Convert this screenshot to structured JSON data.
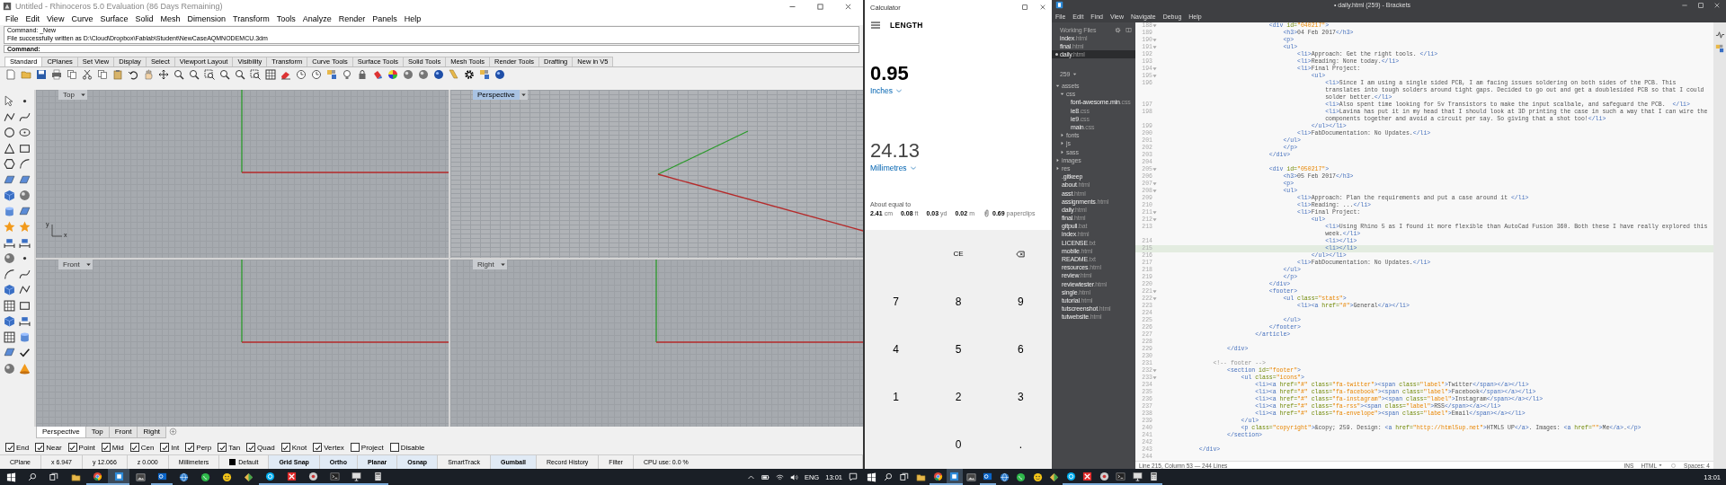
{
  "rhino": {
    "title": "Untitled - Rhinoceros 5.0 Evaluation (86 Days Remaining)",
    "menu": [
      "File",
      "Edit",
      "View",
      "Curve",
      "Surface",
      "Solid",
      "Mesh",
      "Dimension",
      "Transform",
      "Tools",
      "Analyze",
      "Render",
      "Panels",
      "Help"
    ],
    "command_history": [
      "Command: _New",
      "File successfully written as D:\\Cloud\\Dropbox\\Fablab\\Student\\NewCaseAQMNODEMCU.3dm"
    ],
    "command_prompt": "Command:",
    "toolbar_tabs": [
      {
        "label": "Standard",
        "selected": true
      },
      {
        "label": "CPlanes",
        "selected": false
      },
      {
        "label": "Set View",
        "selected": false
      },
      {
        "label": "Display",
        "selected": false
      },
      {
        "label": "Select",
        "selected": false
      },
      {
        "label": "Viewport Layout",
        "selected": false
      },
      {
        "label": "Visibility",
        "selected": false
      },
      {
        "label": "Transform",
        "selected": false
      },
      {
        "label": "Curve Tools",
        "selected": false
      },
      {
        "label": "Surface Tools",
        "selected": false
      },
      {
        "label": "Solid Tools",
        "selected": false
      },
      {
        "label": "Mesh Tools",
        "selected": false
      },
      {
        "label": "Render Tools",
        "selected": false
      },
      {
        "label": "Drafting",
        "selected": false
      },
      {
        "label": "New in V5",
        "selected": false
      }
    ],
    "viewports": [
      {
        "name": "Top",
        "selected": false,
        "kind": "parallel",
        "axis_labels": [
          "y",
          "x"
        ]
      },
      {
        "name": "Perspective",
        "selected": true,
        "kind": "perspective"
      },
      {
        "name": "Front",
        "selected": false,
        "kind": "parallel"
      },
      {
        "name": "Right",
        "selected": false,
        "kind": "parallel"
      }
    ],
    "viewport_tabs": [
      {
        "label": "Perspective",
        "selected": true
      },
      {
        "label": "Top",
        "selected": false
      },
      {
        "label": "Front",
        "selected": false
      },
      {
        "label": "Right",
        "selected": false
      }
    ],
    "osnaps": [
      {
        "label": "End",
        "checked": true
      },
      {
        "label": "Near",
        "checked": true
      },
      {
        "label": "Point",
        "checked": true
      },
      {
        "label": "Mid",
        "checked": true
      },
      {
        "label": "Cen",
        "checked": true
      },
      {
        "label": "Int",
        "checked": true
      },
      {
        "label": "Perp",
        "checked": true
      },
      {
        "label": "Tan",
        "checked": true
      },
      {
        "label": "Quad",
        "checked": true
      },
      {
        "label": "Knot",
        "checked": true
      },
      {
        "label": "Vertex",
        "checked": true
      },
      {
        "label": "Project",
        "checked": false
      },
      {
        "label": "Disable",
        "checked": false
      }
    ],
    "status_bar": [
      {
        "kind": "field",
        "text": "CPlane"
      },
      {
        "kind": "field",
        "text": "x 6.947"
      },
      {
        "kind": "field",
        "text": "y 12.066"
      },
      {
        "kind": "field",
        "text": "z 0.000"
      },
      {
        "kind": "field",
        "text": "Millimeters"
      },
      {
        "kind": "layer",
        "text": "Default"
      },
      {
        "kind": "toggle",
        "text": "Grid Snap",
        "on": true
      },
      {
        "kind": "toggle",
        "text": "Ortho",
        "on": true
      },
      {
        "kind": "toggle",
        "text": "Planar",
        "on": true
      },
      {
        "kind": "toggle",
        "text": "Osnap",
        "on": true
      },
      {
        "kind": "toggle",
        "text": "SmartTrack",
        "on": false
      },
      {
        "kind": "toggle",
        "text": "Gumball",
        "on": true
      },
      {
        "kind": "toggle",
        "text": "Record History",
        "on": false
      },
      {
        "kind": "toggle",
        "text": "Filter",
        "on": false
      },
      {
        "kind": "memo",
        "text": "CPU use: 0.0 %"
      }
    ]
  },
  "calculator": {
    "title": "Calculator",
    "mode": "LENGTH",
    "conversions": [
      {
        "value": "0.95",
        "unit": "Inches",
        "selected": true
      },
      {
        "value": "24.13",
        "unit": "Millimetres",
        "selected": false
      }
    ],
    "about_label": "About equal to",
    "equivalents": [
      {
        "kind": "plain",
        "value": "2.41",
        "unit": "cm"
      },
      {
        "kind": "plain",
        "value": "0.08",
        "unit": "ft"
      },
      {
        "kind": "plain",
        "value": "0.03",
        "unit": "yd"
      },
      {
        "kind": "plain",
        "value": "0.02",
        "unit": "m"
      },
      {
        "kind": "paperclip",
        "value": "0.69",
        "unit": "paperclips"
      }
    ],
    "key_rows": [
      [
        {
          "kind": "text",
          "label": "CE"
        },
        {
          "kind": "backspace"
        }
      ],
      [
        {
          "kind": "text",
          "label": "7"
        },
        {
          "kind": "text",
          "label": "8"
        },
        {
          "kind": "text",
          "label": "9"
        }
      ],
      [
        {
          "kind": "text",
          "label": "4"
        },
        {
          "kind": "text",
          "label": "5"
        },
        {
          "kind": "text",
          "label": "6"
        }
      ],
      [
        {
          "kind": "text",
          "label": "1"
        },
        {
          "kind": "text",
          "label": "2"
        },
        {
          "kind": "text",
          "label": "3"
        }
      ],
      [
        {
          "kind": "text",
          "label": "0"
        },
        {
          "kind": "text",
          "label": "."
        }
      ]
    ]
  },
  "brackets": {
    "title": "• daily.html (259) - Brackets",
    "menu": [
      "File",
      "Edit",
      "Find",
      "View",
      "Navigate",
      "Debug",
      "Help"
    ],
    "working_files_label": "Working Files",
    "working_files": [
      {
        "name": "index.html",
        "selected": false,
        "modified": false
      },
      {
        "name": "final.html",
        "selected": false,
        "modified": false
      },
      {
        "name": "daily.html",
        "selected": true,
        "modified": true
      }
    ],
    "project": "259",
    "tree": [
      {
        "kind": "folder",
        "name": "assets",
        "expanded": true,
        "children": [
          {
            "kind": "folder",
            "name": "css",
            "expanded": true,
            "children": [
              {
                "kind": "file",
                "name": "font-awesome.min.css"
              },
              {
                "kind": "file",
                "name": "ie8.css"
              },
              {
                "kind": "file",
                "name": "ie9.css"
              },
              {
                "kind": "file",
                "name": "main.css"
              }
            ]
          },
          {
            "kind": "folder",
            "name": "fonts",
            "expanded": false
          },
          {
            "kind": "folder",
            "name": "js",
            "expanded": false
          },
          {
            "kind": "folder",
            "name": "sass",
            "expanded": false
          }
        ]
      },
      {
        "kind": "folder",
        "name": "images",
        "expanded": false
      },
      {
        "kind": "folder",
        "name": "res",
        "expanded": false
      },
      {
        "kind": "file",
        "name": ".gitkeep"
      },
      {
        "kind": "file",
        "name": "about.html"
      },
      {
        "kind": "file",
        "name": "asst.html"
      },
      {
        "kind": "file",
        "name": "assignments.html"
      },
      {
        "kind": "file",
        "name": "daily.html"
      },
      {
        "kind": "file",
        "name": "final.html"
      },
      {
        "kind": "file",
        "name": "gitpull.bat"
      },
      {
        "kind": "file",
        "name": "index.html"
      },
      {
        "kind": "file",
        "name": "LICENSE.txt"
      },
      {
        "kind": "file",
        "name": "mobile.html"
      },
      {
        "kind": "file",
        "name": "README.txt"
      },
      {
        "kind": "file",
        "name": "resources.html"
      },
      {
        "kind": "file",
        "name": "review.html"
      },
      {
        "kind": "file",
        "name": "reviewtester.html"
      },
      {
        "kind": "file",
        "name": "single.html"
      },
      {
        "kind": "file",
        "name": "tutorial.html"
      },
      {
        "kind": "file",
        "name": "tutscreenshot.html"
      },
      {
        "kind": "file",
        "name": "tutwebsite.html"
      }
    ],
    "lines": [
      {
        "n": "188",
        "code": "                                <div id=\"040217\">",
        "fold": true,
        "current": false
      },
      {
        "n": "189",
        "code": "                                    <h3>04 Feb 2017</h3>",
        "fold": false,
        "current": false
      },
      {
        "n": "190",
        "code": "                                    <p>",
        "fold": true,
        "current": false
      },
      {
        "n": "191",
        "code": "                                    <ul>",
        "fold": true,
        "current": false
      },
      {
        "n": "192",
        "code": "                                        <li>Approach: Get the right tools. </li>",
        "fold": false,
        "current": false
      },
      {
        "n": "193",
        "code": "                                        <li>Reading: None today.</li>",
        "fold": false,
        "current": false
      },
      {
        "n": "194",
        "code": "                                        <li>Final Project:",
        "fold": true,
        "current": false
      },
      {
        "n": "195",
        "code": "                                            <ul>",
        "fold": true,
        "current": false
      },
      {
        "n": "196",
        "code": "                                                <li>Since I am using a single sided PCB, I am facing issues soldering on both sides of the PCB. This translates into tough solders around tight gaps. Decided to go out and get a doublesided PCB so that I could solder better.</li>",
        "fold": false,
        "current": false
      },
      {
        "n": "197",
        "code": "                                                <li>Also spent time looking for 5v Transistors to make the input scalbale, and safeguard the PCB.  </li>",
        "fold": false,
        "current": false
      },
      {
        "n": "198",
        "code": "                                                <li>Lavina has put it in my head that I should look at 3D printing the case in such a way that I can wire the components together and avoid a circuit per say. So giving that a shot too!</li>",
        "fold": false,
        "current": false
      },
      {
        "n": "199",
        "code": "                                            </ul></li>",
        "fold": false,
        "current": false
      },
      {
        "n": "200",
        "code": "                                        <li>FabDocumentation: No Updates.</li>",
        "fold": false,
        "current": false
      },
      {
        "n": "201",
        "code": "                                    </ul>",
        "fold": false,
        "current": false
      },
      {
        "n": "202",
        "code": "                                    </p>",
        "fold": false,
        "current": false
      },
      {
        "n": "203",
        "code": "                                </div>",
        "fold": false,
        "current": false
      },
      {
        "n": "204",
        "fold": false,
        "current": false
      },
      {
        "n": "205",
        "code": "                                <div id=\"050217\">",
        "fold": true,
        "current": false
      },
      {
        "n": "206",
        "code": "                                    <h3>05 Feb 2017</h3>",
        "fold": false,
        "current": false
      },
      {
        "n": "207",
        "code": "                                    <p>",
        "fold": true,
        "current": false
      },
      {
        "n": "208",
        "code": "                                    <ul>",
        "fold": true,
        "current": false
      },
      {
        "n": "209",
        "code": "                                        <li>Approach: Plan the requirements and put a case around it </li>",
        "fold": false,
        "current": false
      },
      {
        "n": "210",
        "code": "                                        <li>Reading: ...</li>",
        "fold": false,
        "current": false
      },
      {
        "n": "211",
        "code": "                                        <li>Final Project:",
        "fold": true,
        "current": false
      },
      {
        "n": "212",
        "code": "                                            <ul>",
        "fold": true,
        "current": false
      },
      {
        "n": "213",
        "code": "                                                <li>Using Rhino 5 as I found it more flexible than AutoCad Fusion 360. Both these I have really explored this week.</li>",
        "fold": false,
        "current": false
      },
      {
        "n": "214",
        "code": "                                                <li></li>",
        "fold": false,
        "current": false
      },
      {
        "n": "215",
        "code": "                                                <li></li>",
        "fold": false,
        "current": true
      },
      {
        "n": "216",
        "code": "                                            </ul></li>",
        "fold": false,
        "current": false
      },
      {
        "n": "217",
        "code": "                                        <li>FabDocumentation: No Updates.</li>",
        "fold": false,
        "current": false
      },
      {
        "n": "218",
        "code": "                                    </ul>",
        "fold": false,
        "current": false
      },
      {
        "n": "219",
        "code": "                                    </p>",
        "fold": false,
        "current": false
      },
      {
        "n": "220",
        "code": "                                </div>",
        "fold": false,
        "current": false
      },
      {
        "n": "221",
        "code": "                                <footer>",
        "fold": true,
        "current": false
      },
      {
        "n": "222",
        "code": "                                    <ul class=\"stats\">",
        "fold": true,
        "current": false
      },
      {
        "n": "223",
        "code": "                                        <li><a href=\"#\">General</a></li>",
        "fold": false,
        "current": false
      },
      {
        "n": "224",
        "fold": false,
        "current": false
      },
      {
        "n": "225",
        "code": "                                    </ul>",
        "fold": false,
        "current": false
      },
      {
        "n": "226",
        "code": "                                </footer>",
        "fold": false,
        "current": false
      },
      {
        "n": "227",
        "code": "                            </article>",
        "fold": false,
        "current": false
      },
      {
        "n": "228",
        "fold": false,
        "current": false
      },
      {
        "n": "229",
        "code": "                    </div>",
        "fold": false,
        "current": false
      },
      {
        "n": "230",
        "fold": false,
        "current": false
      },
      {
        "n": "231",
        "code": "                <!-- footer -->",
        "fold": false,
        "current": false
      },
      {
        "n": "232",
        "code": "                    <section id=\"footer\">",
        "fold": true,
        "current": false
      },
      {
        "n": "233",
        "code": "                        <ul class=\"icons\">",
        "fold": true,
        "current": false
      },
      {
        "n": "234",
        "code": "                            <li><a href=\"#\" class=\"fa-twitter\"><span class=\"label\">Twitter</span></a></li>",
        "fold": false,
        "current": false
      },
      {
        "n": "235",
        "code": "                            <li><a href=\"#\" class=\"fa-facebook\"><span class=\"label\">Facebook</span></a></li>",
        "fold": false,
        "current": false
      },
      {
        "n": "236",
        "code": "                            <li><a href=\"#\" class=\"fa-instagram\"><span class=\"label\">Instagram</span></a></li>",
        "fold": false,
        "current": false
      },
      {
        "n": "237",
        "code": "                            <li><a href=\"#\" class=\"fa-rss\"><span class=\"label\">RSS</span></a></li>",
        "fold": false,
        "current": false
      },
      {
        "n": "238",
        "code": "                            <li><a href=\"#\" class=\"fa-envelope\"><span class=\"label\">Email</span></a></li>",
        "fold": false,
        "current": false
      },
      {
        "n": "239",
        "code": "                        </ul>",
        "fold": false,
        "current": false
      },
      {
        "n": "240",
        "code": "                        <p class=\"copyright\">&copy; 259. Design: <a href=\"http://html5up.net\">HTML5 UP</a>. Images: <a href=\"\">Me</a>.</p>",
        "fold": false,
        "current": false
      },
      {
        "n": "241",
        "code": "                    </section>",
        "fold": false,
        "current": false
      },
      {
        "n": "242",
        "fold": false,
        "current": false
      },
      {
        "n": "243",
        "code": "            </div>",
        "fold": false,
        "current": false
      },
      {
        "n": "244",
        "fold": false,
        "current": false
      }
    ],
    "status": {
      "position": "Line 215, Column 53 — 244 Lines",
      "mode": "INS",
      "language": "HTML",
      "indent": "Spaces: 4"
    }
  },
  "taskbars": [
    {
      "apps": [
        {
          "kind": "folder",
          "running": false,
          "selected": false
        },
        {
          "kind": "browser",
          "running": true,
          "selected": false
        },
        {
          "kind": "window",
          "running": true,
          "selected": true
        },
        {
          "kind": "picture",
          "running": false,
          "selected": false
        },
        {
          "kind": "mail",
          "running": true,
          "selected": false
        },
        {
          "kind": "globe",
          "running": false,
          "selected": false
        },
        {
          "kind": "chat",
          "running": false,
          "selected": false
        },
        {
          "kind": "smiley",
          "running": false,
          "selected": false
        },
        {
          "kind": "diamond",
          "running": false,
          "selected": false
        },
        {
          "kind": "bubble",
          "running": true,
          "selected": false
        },
        {
          "kind": "cross",
          "running": true,
          "selected": false
        },
        {
          "kind": "disc",
          "running": true,
          "selected": false
        },
        {
          "kind": "terminal",
          "running": true,
          "selected": false
        },
        {
          "kind": "monitor",
          "running": true,
          "selected": false
        },
        {
          "kind": "calculator",
          "running": true,
          "selected": false
        }
      ],
      "tray": [
        {
          "kind": "chevron-up"
        },
        {
          "kind": "battery"
        },
        {
          "kind": "wifi"
        },
        {
          "kind": "volume"
        }
      ],
      "language": "ENG",
      "time": "13:01"
    },
    {
      "apps": [
        {
          "kind": "folder",
          "running": false,
          "selected": false
        },
        {
          "kind": "browser",
          "running": true,
          "selected": false
        },
        {
          "kind": "window",
          "running": true,
          "selected": true
        },
        {
          "kind": "picture",
          "running": false,
          "selected": false
        },
        {
          "kind": "mail",
          "running": true,
          "selected": false
        },
        {
          "kind": "globe",
          "running": false,
          "selected": false
        },
        {
          "kind": "chat",
          "running": false,
          "selected": false
        },
        {
          "kind": "smiley",
          "running": false,
          "selected": false
        },
        {
          "kind": "diamond",
          "running": false,
          "selected": false
        },
        {
          "kind": "bubble",
          "running": true,
          "selected": false
        },
        {
          "kind": "cross",
          "running": true,
          "selected": false
        },
        {
          "kind": "disc",
          "running": true,
          "selected": false
        },
        {
          "kind": "terminal",
          "running": true,
          "selected": false
        },
        {
          "kind": "monitor",
          "running": true,
          "selected": false
        },
        {
          "kind": "calculator",
          "running": true,
          "selected": false
        }
      ],
      "time": "13:01"
    }
  ]
}
